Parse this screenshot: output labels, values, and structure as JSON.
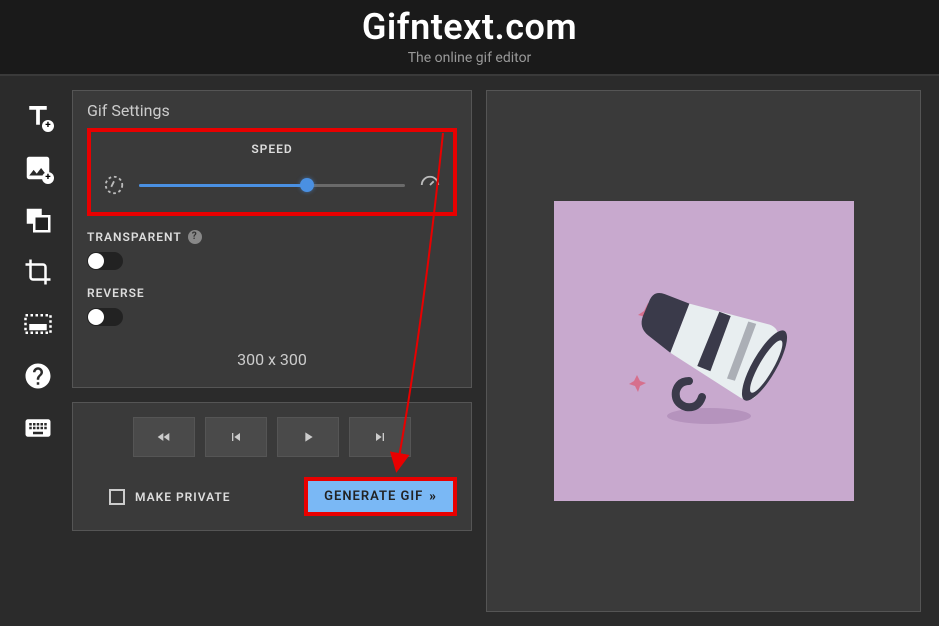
{
  "header": {
    "title": "Gifntext.com",
    "subtitle": "The online gif editor"
  },
  "toolbar": {
    "items": [
      {
        "name": "text-tool",
        "icon": "text"
      },
      {
        "name": "image-tool",
        "icon": "image"
      },
      {
        "name": "shape-tool",
        "icon": "shape"
      },
      {
        "name": "crop-tool",
        "icon": "crop"
      },
      {
        "name": "caption-tool",
        "icon": "caption"
      },
      {
        "name": "help-tool",
        "icon": "help"
      },
      {
        "name": "keyboard-tool",
        "icon": "keyboard"
      }
    ]
  },
  "settings": {
    "panel_title": "Gif Settings",
    "speed_label": "SPEED",
    "speed_value": 63,
    "transparent_label": "TRANSPARENT",
    "transparent_value": false,
    "reverse_label": "REVERSE",
    "reverse_value": false,
    "dimensions": "300 x 300"
  },
  "playback": {
    "private_label": "MAKE PRIVATE",
    "private_value": false,
    "generate_label": "GENERATE GIF"
  },
  "preview": {
    "bg_color": "#c8a9ce"
  },
  "highlights": {
    "speed_box": true,
    "generate_button": true,
    "arrow_color": "#e80000"
  }
}
